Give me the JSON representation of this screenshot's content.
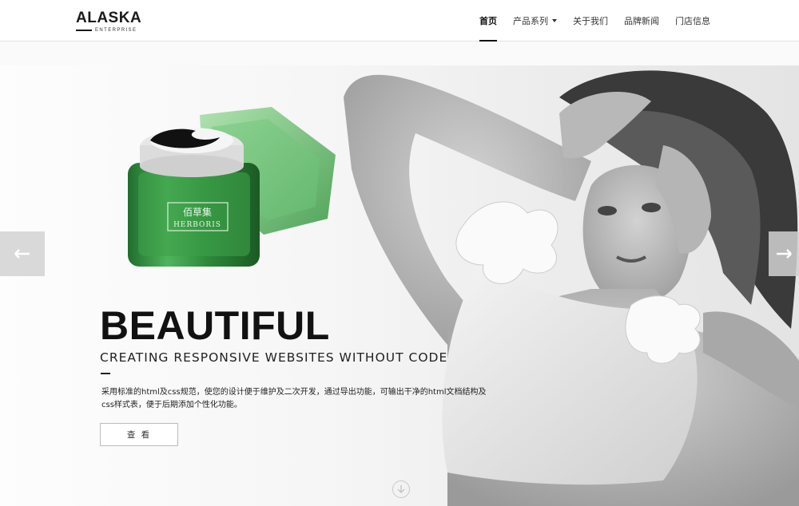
{
  "brand": {
    "name": "ALASKA",
    "sub": "ENTERPRISE"
  },
  "nav": {
    "items": [
      {
        "label": "首页",
        "active": true
      },
      {
        "label": "产品系列",
        "dropdown": true
      },
      {
        "label": "关于我们"
      },
      {
        "label": "品牌新闻"
      },
      {
        "label": "门店信息"
      }
    ]
  },
  "hero": {
    "headline": "BEAUTIFUL",
    "subhead": "CREATING RESPONSIVE WEBSITES WITHOUT CODE",
    "description": "采用标准的html及css规范，使您的设计便于维护及二次开发，通过导出功能，可输出干净的html文档结构及css样式表，便于后期添加个性化功能。",
    "button_label": "查 看",
    "product_label_cn": "佰草集",
    "product_label_en": "HERBORIS"
  },
  "icons": {
    "prev": "arrow-left-icon",
    "next": "arrow-right-icon",
    "scroll": "chevron-down-circle-icon"
  },
  "colors": {
    "jar_green": "#3f9a4c",
    "text_dark": "#111111"
  }
}
